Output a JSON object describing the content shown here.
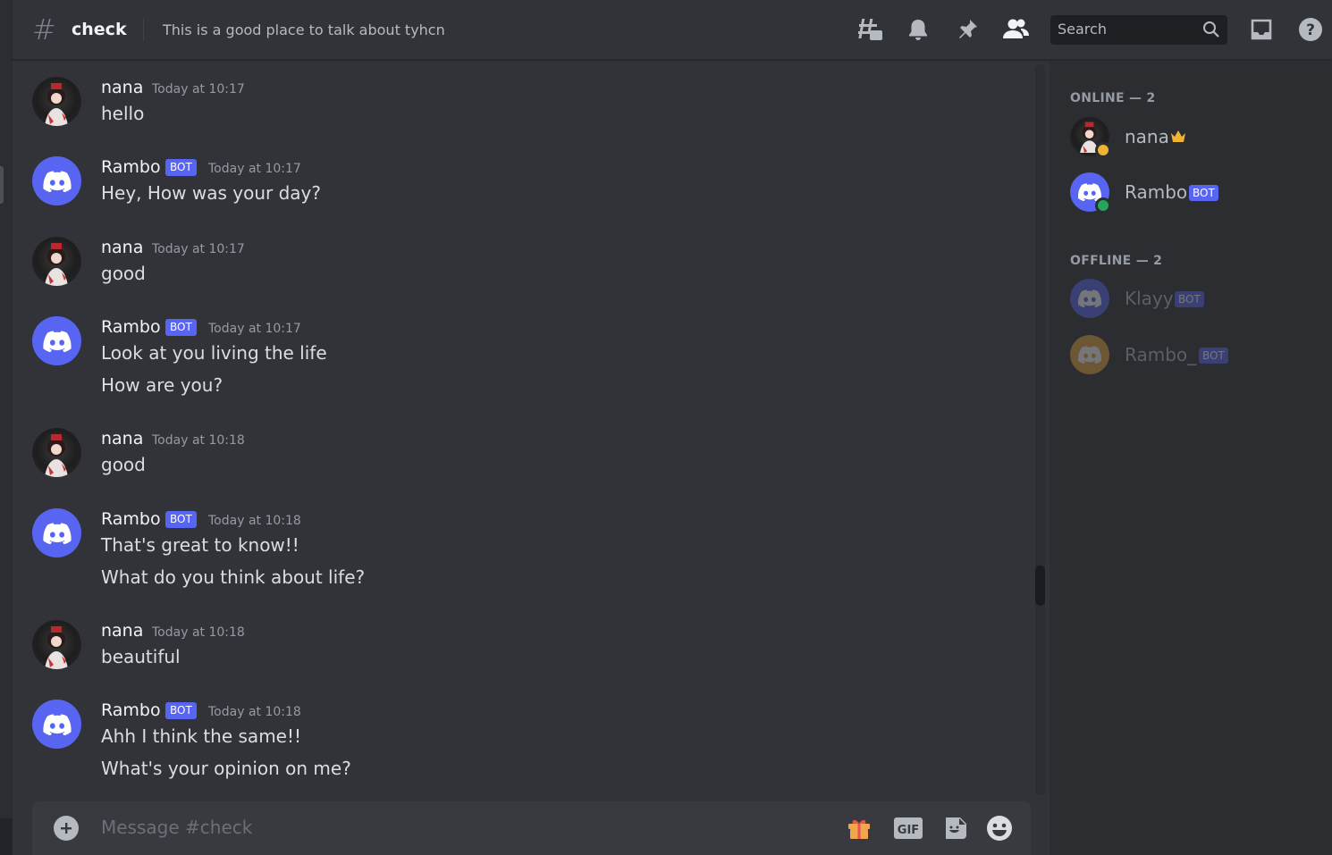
{
  "header": {
    "channel_name": "check",
    "topic": "This is a good place to talk about tyhcn",
    "search_placeholder": "Search"
  },
  "messages": [
    {
      "author": "nana",
      "bot": false,
      "timestamp": "Today at 10:17",
      "lines": [
        "hello"
      ]
    },
    {
      "author": "Rambo",
      "bot": true,
      "bot_label": "BOT",
      "timestamp": "Today at 10:17",
      "lines": [
        "Hey, How was your day?"
      ]
    },
    {
      "author": "nana",
      "bot": false,
      "timestamp": "Today at 10:17",
      "lines": [
        "good"
      ]
    },
    {
      "author": "Rambo",
      "bot": true,
      "bot_label": "BOT",
      "timestamp": "Today at 10:17",
      "lines": [
        "Look at you living the life",
        "How are you?"
      ]
    },
    {
      "author": "nana",
      "bot": false,
      "timestamp": "Today at 10:18",
      "lines": [
        "good"
      ]
    },
    {
      "author": "Rambo",
      "bot": true,
      "bot_label": "BOT",
      "timestamp": "Today at 10:18",
      "lines": [
        "That's great to know!!",
        "What do you think about life?"
      ]
    },
    {
      "author": "nana",
      "bot": false,
      "timestamp": "Today at 10:18",
      "lines": [
        "beautiful"
      ]
    },
    {
      "author": "Rambo",
      "bot": true,
      "bot_label": "BOT",
      "timestamp": "Today at 10:18",
      "lines": [
        "Ahh I think the same!!",
        "What's your opinion on me?"
      ]
    }
  ],
  "composer": {
    "placeholder": "Message #check"
  },
  "members": {
    "online_header": "ONLINE — 2",
    "offline_header": "OFFLINE — 2",
    "online": [
      {
        "name": "nana",
        "badge": "crown-icon",
        "status": "idle"
      },
      {
        "name": "Rambo",
        "bot_label": "BOT",
        "status": "online"
      }
    ],
    "offline": [
      {
        "name": "Klayy",
        "bot_label": "BOT"
      },
      {
        "name": "Rambo_",
        "bot_label": "BOT"
      }
    ]
  },
  "colors": {
    "blurple": "#5865f2",
    "online_green": "#23a55a",
    "idle_yellow": "#f0b232",
    "crown": "#f0b232"
  }
}
